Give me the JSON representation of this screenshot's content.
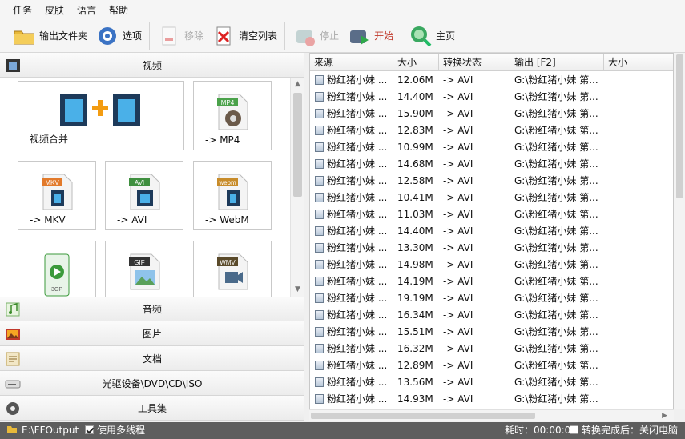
{
  "menu": [
    "任务",
    "皮肤",
    "语言",
    "帮助"
  ],
  "toolbar": {
    "output_folder": "输出文件夹",
    "options": "选项",
    "remove": "移除",
    "clear_list": "清空列表",
    "stop": "停止",
    "start": "开始",
    "home": "主页"
  },
  "categories": {
    "video": "视频",
    "audio": "音频",
    "image": "图片",
    "document": "文档",
    "disc": "光驱设备\\DVD\\CD\\ISO",
    "tools": "工具集"
  },
  "tiles": [
    {
      "label": "视频合并",
      "badge": ""
    },
    {
      "label": "-> MP4",
      "badge": "MP4"
    },
    {
      "label": "-> MKV",
      "badge": "MKV"
    },
    {
      "label": "-> AVI",
      "badge": "AVI"
    },
    {
      "label": "-> WebM",
      "badge": "webm"
    },
    {
      "label": "",
      "badge": "3GP"
    },
    {
      "label": "",
      "badge": "GIF"
    },
    {
      "label": "",
      "badge": "WMV"
    }
  ],
  "table": {
    "headers": [
      "来源",
      "大小",
      "转换状态",
      "输出 [F2]",
      "大小"
    ],
    "rows": [
      {
        "source": "粉红猪小妹 ...",
        "size": "12.06M",
        "status": "-> AVI",
        "output": "G:\\粉红猪小妹 第..."
      },
      {
        "source": "粉红猪小妹 ...",
        "size": "14.40M",
        "status": "-> AVI",
        "output": "G:\\粉红猪小妹 第..."
      },
      {
        "source": "粉红猪小妹 ...",
        "size": "15.90M",
        "status": "-> AVI",
        "output": "G:\\粉红猪小妹 第..."
      },
      {
        "source": "粉红猪小妹 ...",
        "size": "12.83M",
        "status": "-> AVI",
        "output": "G:\\粉红猪小妹 第..."
      },
      {
        "source": "粉红猪小妹 ...",
        "size": "10.99M",
        "status": "-> AVI",
        "output": "G:\\粉红猪小妹 第..."
      },
      {
        "source": "粉红猪小妹 ...",
        "size": "14.68M",
        "status": "-> AVI",
        "output": "G:\\粉红猪小妹 第..."
      },
      {
        "source": "粉红猪小妹 ...",
        "size": "12.58M",
        "status": "-> AVI",
        "output": "G:\\粉红猪小妹 第..."
      },
      {
        "source": "粉红猪小妹 ...",
        "size": "10.41M",
        "status": "-> AVI",
        "output": "G:\\粉红猪小妹 第..."
      },
      {
        "source": "粉红猪小妹 ...",
        "size": "11.03M",
        "status": "-> AVI",
        "output": "G:\\粉红猪小妹 第..."
      },
      {
        "source": "粉红猪小妹 ...",
        "size": "14.40M",
        "status": "-> AVI",
        "output": "G:\\粉红猪小妹 第..."
      },
      {
        "source": "粉红猪小妹 ...",
        "size": "13.30M",
        "status": "-> AVI",
        "output": "G:\\粉红猪小妹 第..."
      },
      {
        "source": "粉红猪小妹 ...",
        "size": "14.98M",
        "status": "-> AVI",
        "output": "G:\\粉红猪小妹 第..."
      },
      {
        "source": "粉红猪小妹 ...",
        "size": "14.19M",
        "status": "-> AVI",
        "output": "G:\\粉红猪小妹 第..."
      },
      {
        "source": "粉红猪小妹 ...",
        "size": "19.19M",
        "status": "-> AVI",
        "output": "G:\\粉红猪小妹 第..."
      },
      {
        "source": "粉红猪小妹 ...",
        "size": "16.34M",
        "status": "-> AVI",
        "output": "G:\\粉红猪小妹 第..."
      },
      {
        "source": "粉红猪小妹 ...",
        "size": "15.51M",
        "status": "-> AVI",
        "output": "G:\\粉红猪小妹 第..."
      },
      {
        "source": "粉红猪小妹 ...",
        "size": "16.32M",
        "status": "-> AVI",
        "output": "G:\\粉红猪小妹 第..."
      },
      {
        "source": "粉红猪小妹 ...",
        "size": "12.89M",
        "status": "-> AVI",
        "output": "G:\\粉红猪小妹 第..."
      },
      {
        "source": "粉红猪小妹 ...",
        "size": "13.56M",
        "status": "-> AVI",
        "output": "G:\\粉红猪小妹 第..."
      },
      {
        "source": "粉红猪小妹 ...",
        "size": "14.93M",
        "status": "-> AVI",
        "output": "G:\\粉红猪小妹 第..."
      }
    ]
  },
  "status": {
    "output_path": "E:\\FFOutput",
    "multithread": "使用多线程",
    "elapsed": "耗时：00:00:00",
    "shutdown": "转换完成后：关闭电脑"
  },
  "colors": {
    "statusbar": "#5e5e5e",
    "start": "#c0392b",
    "accent": "#2b6cb0"
  }
}
